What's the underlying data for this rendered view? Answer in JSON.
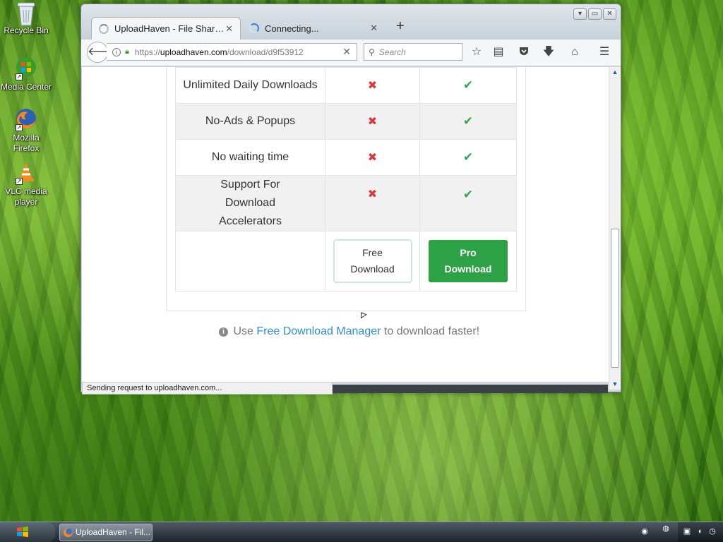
{
  "desktop": {
    "icons": [
      {
        "label": "Recycle Bin",
        "icon": "recycle-bin-icon"
      },
      {
        "label": "Media Center",
        "icon": "media-center-icon"
      },
      {
        "label": "Mozilla Firefox",
        "icon": "firefox-icon"
      },
      {
        "label": "VLC media player",
        "icon": "vlc-icon"
      }
    ]
  },
  "browser": {
    "tabs": [
      {
        "title": "UploadHaven - File Sharin...",
        "close": "✕",
        "state": "active"
      },
      {
        "title": "Connecting...",
        "close": "✕",
        "state": "loading"
      }
    ],
    "new_tab": "+",
    "window_buttons": [
      "▾",
      "▭",
      "✕"
    ],
    "url": {
      "scheme": "https://",
      "host": "uploadhaven.com",
      "path": "/download/d9f53912"
    },
    "search_placeholder": "Search",
    "status_text": "Sending request to uploadhaven.com..."
  },
  "page": {
    "features": [
      {
        "name": "Unlimited Daily Downloads",
        "free": "✖",
        "pro": "✔"
      },
      {
        "name": "No-Ads & Popups",
        "free": "✖",
        "pro": "✔"
      },
      {
        "name": "No waiting time",
        "free": "✖",
        "pro": "✔"
      },
      {
        "name": "Support For Download Accelerators",
        "free": "✖",
        "pro": "✔"
      }
    ],
    "free_button": {
      "line1": "Free",
      "line2": "Download"
    },
    "pro_button": {
      "line1": "Pro",
      "line2": "Download"
    },
    "tip": {
      "prefix": "Use",
      "link": "Free Download Manager",
      "suffix": "to download faster!"
    }
  },
  "taskbar": {
    "task_label": "UploadHaven - Fil..."
  },
  "colors": {
    "pro_green": "#2ca145",
    "check_green": "#2ea94f",
    "cross_red": "#d9383e",
    "link_blue": "#2f8fce"
  }
}
